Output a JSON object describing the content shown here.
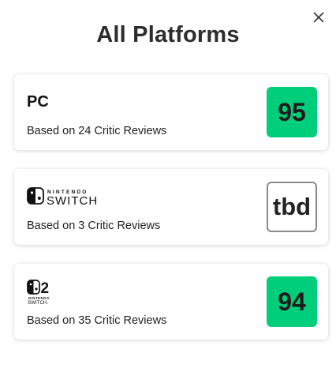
{
  "modal": {
    "title": "All Platforms",
    "close_icon": "close-icon"
  },
  "platforms": [
    {
      "name": "PC",
      "logo": null,
      "reviews_text": "Based on 24 Critic Reviews",
      "score": "95",
      "score_color": "#00ce7a"
    },
    {
      "name": "",
      "logo": "nintendo-switch-logo",
      "logo_text_top": "NINTENDO",
      "logo_text_main": "SWITCH",
      "reviews_text": "Based on 3 Critic Reviews",
      "score": "tbd",
      "score_color": "#ffffff"
    },
    {
      "name": "",
      "logo": "nintendo-switch-2-logo",
      "logo_text_top": "NINTENDO",
      "logo_text_main": "SWITCH.",
      "reviews_text": "Based on 35 Critic Reviews",
      "score": "94",
      "score_color": "#00ce7a"
    }
  ]
}
